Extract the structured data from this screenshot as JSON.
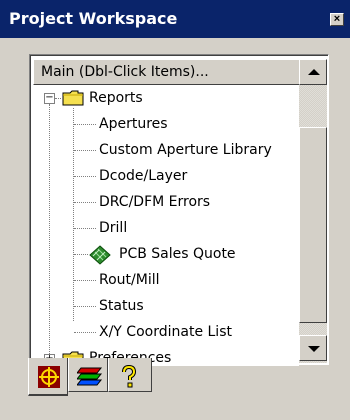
{
  "window": {
    "title": "Project Workspace",
    "close_label": "×"
  },
  "combo": {
    "selected": "Main (Dbl-Click Items)..."
  },
  "tree": {
    "reports_label": "Reports",
    "reports_expander": "−",
    "reports_children": [
      {
        "label": "Apertures",
        "icon": ""
      },
      {
        "label": "Custom Aperture Library",
        "icon": ""
      },
      {
        "label": "Dcode/Layer",
        "icon": ""
      },
      {
        "label": "DRC/DFM Errors",
        "icon": ""
      },
      {
        "label": "Drill",
        "icon": ""
      },
      {
        "label": "PCB Sales Quote",
        "icon": "pcb-board-icon"
      },
      {
        "label": "Rout/Mill",
        "icon": ""
      },
      {
        "label": "Status",
        "icon": ""
      },
      {
        "label": "X/Y Coordinate List",
        "icon": ""
      }
    ],
    "preferences_label": "Preferences",
    "preferences_expander": "+"
  },
  "tabs": [
    {
      "name": "target-tab",
      "icon": "crosshair-target-icon",
      "active": true
    },
    {
      "name": "layers-tab",
      "icon": "layers-stack-icon",
      "active": false
    },
    {
      "name": "help-tab",
      "icon": "question-mark-icon",
      "active": false
    }
  ],
  "colors": {
    "titlebar": "#0a246a",
    "folder": "#f5e050",
    "chrome": "#d4d0c8"
  }
}
